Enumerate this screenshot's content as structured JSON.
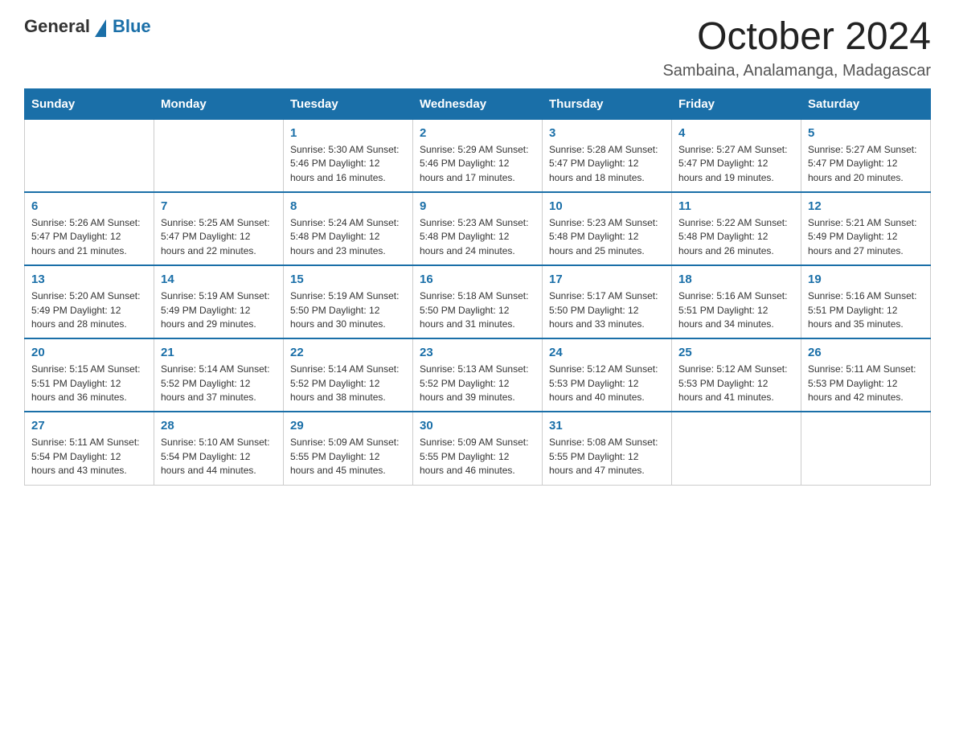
{
  "header": {
    "logo": {
      "general": "General",
      "blue": "Blue"
    },
    "title": "October 2024",
    "location": "Sambaina, Analamanga, Madagascar"
  },
  "days_of_week": [
    "Sunday",
    "Monday",
    "Tuesday",
    "Wednesday",
    "Thursday",
    "Friday",
    "Saturday"
  ],
  "weeks": [
    [
      {
        "day": "",
        "info": ""
      },
      {
        "day": "",
        "info": ""
      },
      {
        "day": "1",
        "info": "Sunrise: 5:30 AM\nSunset: 5:46 PM\nDaylight: 12 hours\nand 16 minutes."
      },
      {
        "day": "2",
        "info": "Sunrise: 5:29 AM\nSunset: 5:46 PM\nDaylight: 12 hours\nand 17 minutes."
      },
      {
        "day": "3",
        "info": "Sunrise: 5:28 AM\nSunset: 5:47 PM\nDaylight: 12 hours\nand 18 minutes."
      },
      {
        "day": "4",
        "info": "Sunrise: 5:27 AM\nSunset: 5:47 PM\nDaylight: 12 hours\nand 19 minutes."
      },
      {
        "day": "5",
        "info": "Sunrise: 5:27 AM\nSunset: 5:47 PM\nDaylight: 12 hours\nand 20 minutes."
      }
    ],
    [
      {
        "day": "6",
        "info": "Sunrise: 5:26 AM\nSunset: 5:47 PM\nDaylight: 12 hours\nand 21 minutes."
      },
      {
        "day": "7",
        "info": "Sunrise: 5:25 AM\nSunset: 5:47 PM\nDaylight: 12 hours\nand 22 minutes."
      },
      {
        "day": "8",
        "info": "Sunrise: 5:24 AM\nSunset: 5:48 PM\nDaylight: 12 hours\nand 23 minutes."
      },
      {
        "day": "9",
        "info": "Sunrise: 5:23 AM\nSunset: 5:48 PM\nDaylight: 12 hours\nand 24 minutes."
      },
      {
        "day": "10",
        "info": "Sunrise: 5:23 AM\nSunset: 5:48 PM\nDaylight: 12 hours\nand 25 minutes."
      },
      {
        "day": "11",
        "info": "Sunrise: 5:22 AM\nSunset: 5:48 PM\nDaylight: 12 hours\nand 26 minutes."
      },
      {
        "day": "12",
        "info": "Sunrise: 5:21 AM\nSunset: 5:49 PM\nDaylight: 12 hours\nand 27 minutes."
      }
    ],
    [
      {
        "day": "13",
        "info": "Sunrise: 5:20 AM\nSunset: 5:49 PM\nDaylight: 12 hours\nand 28 minutes."
      },
      {
        "day": "14",
        "info": "Sunrise: 5:19 AM\nSunset: 5:49 PM\nDaylight: 12 hours\nand 29 minutes."
      },
      {
        "day": "15",
        "info": "Sunrise: 5:19 AM\nSunset: 5:50 PM\nDaylight: 12 hours\nand 30 minutes."
      },
      {
        "day": "16",
        "info": "Sunrise: 5:18 AM\nSunset: 5:50 PM\nDaylight: 12 hours\nand 31 minutes."
      },
      {
        "day": "17",
        "info": "Sunrise: 5:17 AM\nSunset: 5:50 PM\nDaylight: 12 hours\nand 33 minutes."
      },
      {
        "day": "18",
        "info": "Sunrise: 5:16 AM\nSunset: 5:51 PM\nDaylight: 12 hours\nand 34 minutes."
      },
      {
        "day": "19",
        "info": "Sunrise: 5:16 AM\nSunset: 5:51 PM\nDaylight: 12 hours\nand 35 minutes."
      }
    ],
    [
      {
        "day": "20",
        "info": "Sunrise: 5:15 AM\nSunset: 5:51 PM\nDaylight: 12 hours\nand 36 minutes."
      },
      {
        "day": "21",
        "info": "Sunrise: 5:14 AM\nSunset: 5:52 PM\nDaylight: 12 hours\nand 37 minutes."
      },
      {
        "day": "22",
        "info": "Sunrise: 5:14 AM\nSunset: 5:52 PM\nDaylight: 12 hours\nand 38 minutes."
      },
      {
        "day": "23",
        "info": "Sunrise: 5:13 AM\nSunset: 5:52 PM\nDaylight: 12 hours\nand 39 minutes."
      },
      {
        "day": "24",
        "info": "Sunrise: 5:12 AM\nSunset: 5:53 PM\nDaylight: 12 hours\nand 40 minutes."
      },
      {
        "day": "25",
        "info": "Sunrise: 5:12 AM\nSunset: 5:53 PM\nDaylight: 12 hours\nand 41 minutes."
      },
      {
        "day": "26",
        "info": "Sunrise: 5:11 AM\nSunset: 5:53 PM\nDaylight: 12 hours\nand 42 minutes."
      }
    ],
    [
      {
        "day": "27",
        "info": "Sunrise: 5:11 AM\nSunset: 5:54 PM\nDaylight: 12 hours\nand 43 minutes."
      },
      {
        "day": "28",
        "info": "Sunrise: 5:10 AM\nSunset: 5:54 PM\nDaylight: 12 hours\nand 44 minutes."
      },
      {
        "day": "29",
        "info": "Sunrise: 5:09 AM\nSunset: 5:55 PM\nDaylight: 12 hours\nand 45 minutes."
      },
      {
        "day": "30",
        "info": "Sunrise: 5:09 AM\nSunset: 5:55 PM\nDaylight: 12 hours\nand 46 minutes."
      },
      {
        "day": "31",
        "info": "Sunrise: 5:08 AM\nSunset: 5:55 PM\nDaylight: 12 hours\nand 47 minutes."
      },
      {
        "day": "",
        "info": ""
      },
      {
        "day": "",
        "info": ""
      }
    ]
  ]
}
